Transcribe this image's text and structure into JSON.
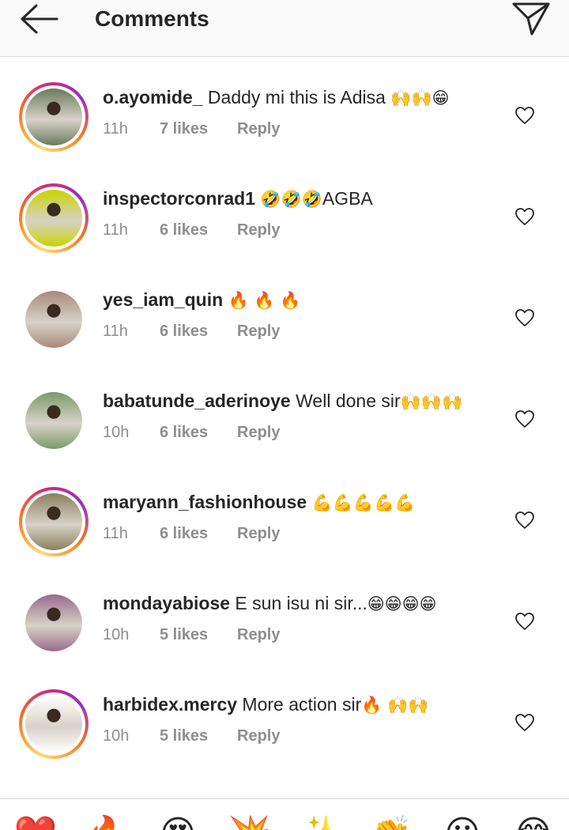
{
  "header": {
    "title": "Comments",
    "back_icon": "arrow-left-icon",
    "send_icon": "paper-plane-icon"
  },
  "comments": [
    {
      "username": "o.ayomide_",
      "text": " Daddy mi this is Adisa ",
      "emoji": "🙌🙌😁",
      "time": "11h",
      "likes": "7 likes",
      "reply": "Reply",
      "story_ring": true,
      "avatar_color": "#6b7a5e"
    },
    {
      "username": "inspectorconrad1",
      "text": " ",
      "emoji": "🤣🤣🤣",
      "text_after": "AGBA",
      "time": "11h",
      "likes": "6 likes",
      "reply": "Reply",
      "story_ring": true,
      "avatar_color": "#c8d400"
    },
    {
      "username": "yes_iam_quin",
      "text": " ",
      "emoji": "🔥 🔥 🔥",
      "time": "11h",
      "likes": "6 likes",
      "reply": "Reply",
      "story_ring": false,
      "avatar_color": "#a88a7a"
    },
    {
      "username": "babatunde_aderinoye",
      "text": " Well done sir",
      "emoji": "🙌🙌🙌",
      "time": "10h",
      "likes": "6 likes",
      "reply": "Reply",
      "story_ring": false,
      "avatar_color": "#7a9a6a"
    },
    {
      "username": "maryann_fashionhouse",
      "text": " ",
      "emoji": "💪💪💪💪💪",
      "time": "11h",
      "likes": "6 likes",
      "reply": "Reply",
      "story_ring": true,
      "avatar_color": "#8a8060"
    },
    {
      "username": "mondayabiose",
      "text": " E sun isu ni sir...",
      "emoji": "😁😁😁😁",
      "time": "10h",
      "likes": "5 likes",
      "reply": "Reply",
      "story_ring": false,
      "avatar_color": "#9a6a8a"
    },
    {
      "username": "harbidex.mercy",
      "text": " More action sir",
      "emoji": "🔥 🙌🙌",
      "time": "10h",
      "likes": "5 likes",
      "reply": "Reply",
      "story_ring": true,
      "avatar_color": "#ffffff"
    }
  ],
  "quick_emojis": [
    "❤️",
    "🔥",
    "😍",
    "💥",
    "✨",
    "👏",
    "😀",
    "😂"
  ],
  "colors": {
    "username": "#262626",
    "meta": "#8e8e8e",
    "divider": "#dbdbdb",
    "header_bg": "#fafafa"
  }
}
